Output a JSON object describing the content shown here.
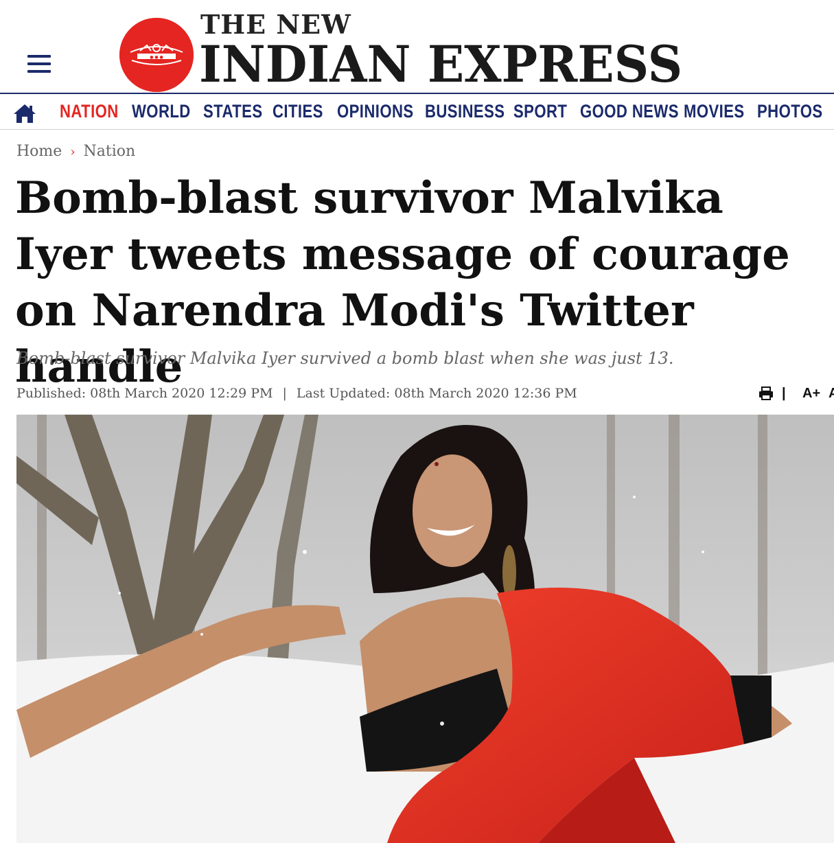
{
  "masthead": {
    "logo_line1": "THE NEW",
    "logo_line2": "INDIAN EXPRESS",
    "brand_red": "#e52521",
    "brand_navy": "#1b2a6b"
  },
  "nav": {
    "items": [
      {
        "label": "NATION",
        "active": true
      },
      {
        "label": "WORLD"
      },
      {
        "label": "STATES"
      },
      {
        "label": "CITIES"
      },
      {
        "label": "OPINIONS"
      },
      {
        "label": "BUSINESS"
      },
      {
        "label": "SPORT"
      },
      {
        "label": "GOOD NEWS"
      },
      {
        "label": "MOVIES"
      },
      {
        "label": "PHOTOS"
      }
    ],
    "home_icon": "home-icon",
    "menu_icon": "hamburger-menu-icon"
  },
  "breadcrumb": {
    "home": "Home",
    "section": "Nation"
  },
  "article": {
    "headline": "Bomb-blast survivor Malvika Iyer tweets message of courage on Narendra Modi's Twitter handle",
    "subhead": "Bomb-blast survivor Malvika Iyer survived a bomb blast when she was just 13.",
    "published": "Published: 08th March 2020 12:29 PM",
    "updated": "Last Updated: 08th March 2020 12:36 PM",
    "separator": "|"
  },
  "tools": {
    "print_icon": "print-icon",
    "pipe": "|",
    "font_increase": "A+",
    "font_decrease": "A-"
  }
}
